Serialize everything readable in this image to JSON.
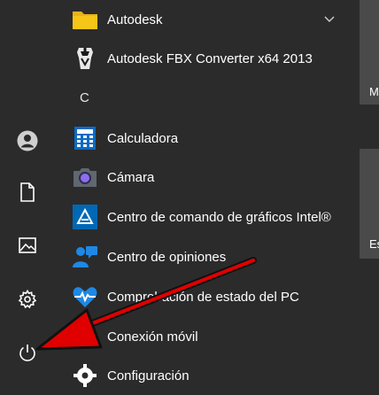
{
  "apps": [
    {
      "label": "Autodesk",
      "icon": "folder-icon"
    },
    {
      "label": "Autodesk FBX Converter x64 2013",
      "icon": "fbx-converter-icon"
    },
    {
      "label": "Calculadora",
      "icon": "calculator-icon"
    },
    {
      "label": "Cámara",
      "icon": "camera-icon"
    },
    {
      "label": "Centro de comando de gráficos Intel®",
      "icon": "intel-graphics-icon"
    },
    {
      "label": "Centro de opiniones",
      "icon": "feedback-hub-icon"
    },
    {
      "label": "Comprobación de estado del PC",
      "icon": "pc-health-icon"
    },
    {
      "label": "Conexión móvil",
      "icon": "mobile-connection-icon"
    },
    {
      "label": "Configuración",
      "icon": "gear-icon"
    }
  ],
  "section_letter": "C",
  "tiles": {
    "top_label": "M",
    "middle_label": "Es"
  },
  "rail": [
    "user-icon",
    "document-icon",
    "pictures-icon",
    "settings-icon",
    "power-icon"
  ],
  "colors": {
    "background": "#2b2b2b",
    "accent_blue": "#1e88e5",
    "arrow_red": "#e00000",
    "folder_yellow": "#f5c518"
  }
}
